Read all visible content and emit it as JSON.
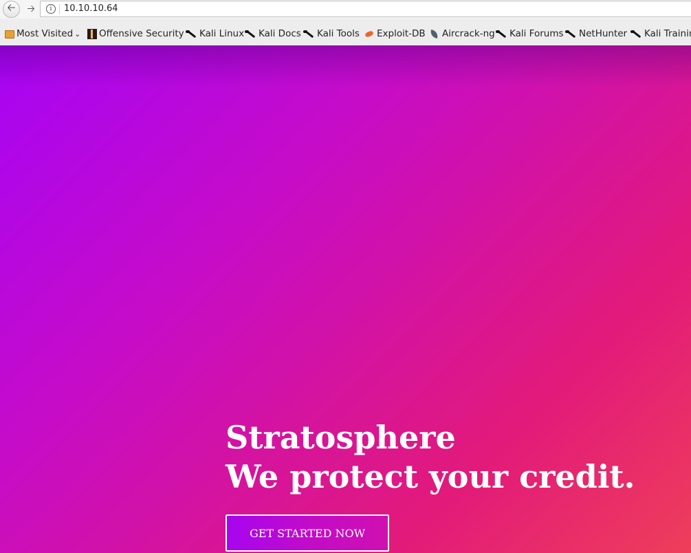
{
  "browser": {
    "url": "10.10.10.64",
    "bookmarks": [
      {
        "label": "Most Visited",
        "icon": "folder-icon",
        "has_dropdown": true
      },
      {
        "label": "Offensive Security",
        "icon": "offensive-security-icon"
      },
      {
        "label": "Kali Linux",
        "icon": "kali-dragon-icon"
      },
      {
        "label": "Kali Docs",
        "icon": "kali-dragon-icon"
      },
      {
        "label": "Kali Tools",
        "icon": "kali-dragon-icon"
      },
      {
        "label": "Exploit-DB",
        "icon": "exploit-db-icon"
      },
      {
        "label": "Aircrack-ng",
        "icon": "aircrack-ng-icon"
      },
      {
        "label": "Kali Forums",
        "icon": "kali-dragon-icon"
      },
      {
        "label": "NetHunter",
        "icon": "kali-dragon-icon"
      },
      {
        "label": "Kali Trainin",
        "icon": "kali-dragon-icon"
      }
    ]
  },
  "hero": {
    "title_line1": "Stratosphere",
    "title_line2": "We protect your credit.",
    "cta_label": "GET STARTED NOW",
    "gradient_colors": [
      "#a704f5",
      "#c60cc7",
      "#e21a7a",
      "#ee3e5a"
    ]
  }
}
